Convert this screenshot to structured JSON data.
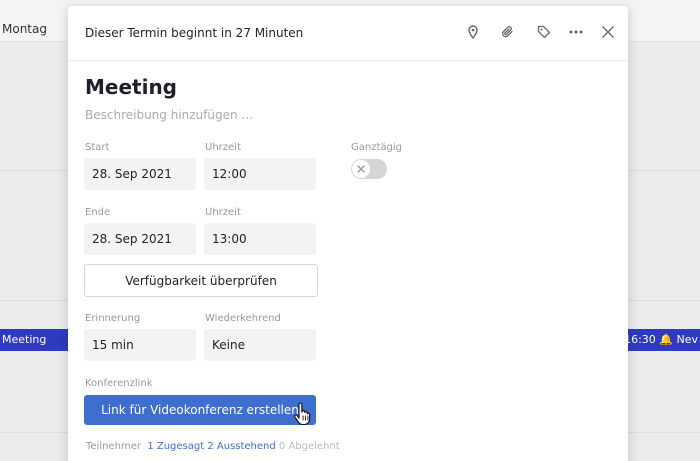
{
  "background": {
    "day_label": "Montag",
    "event_title": "Meeting",
    "event_right": "✓ 16:30 🔔 Nev"
  },
  "modal": {
    "header_text": "Dieser Termin beginnt in 27 Minuten",
    "title": "Meeting",
    "description_placeholder": "Beschreibung hinzufügen ...",
    "start": {
      "label": "Start",
      "date": "28. Sep 2021",
      "time_label": "Uhrzeit",
      "time": "12:00"
    },
    "end": {
      "label": "Ende",
      "date": "28. Sep 2021",
      "time_label": "Uhrzeit",
      "time": "13:00"
    },
    "allday_label": "Ganztägig",
    "availability_button": "Verfügbarkeit überprüfen",
    "reminder": {
      "label": "Erinnerung",
      "value": "15 min"
    },
    "recurring": {
      "label": "Wiederkehrend",
      "value": "Keine"
    },
    "conference": {
      "label": "Konferenzlink",
      "button": "Link für Videokonferenz erstellen"
    },
    "participants": {
      "label": "Teilnehmer",
      "accepted": "1 Zugesagt",
      "pending": "2 Ausstehend",
      "declined": "0 Abgelehnt"
    }
  },
  "colors": {
    "primary": "#3e6fcf",
    "event_bar": "#2f3ac0"
  },
  "icons": [
    "location-pin-icon",
    "paperclip-icon",
    "tag-icon",
    "more-icon",
    "close-icon",
    "toggle-x-icon",
    "hand-cursor-icon"
  ]
}
